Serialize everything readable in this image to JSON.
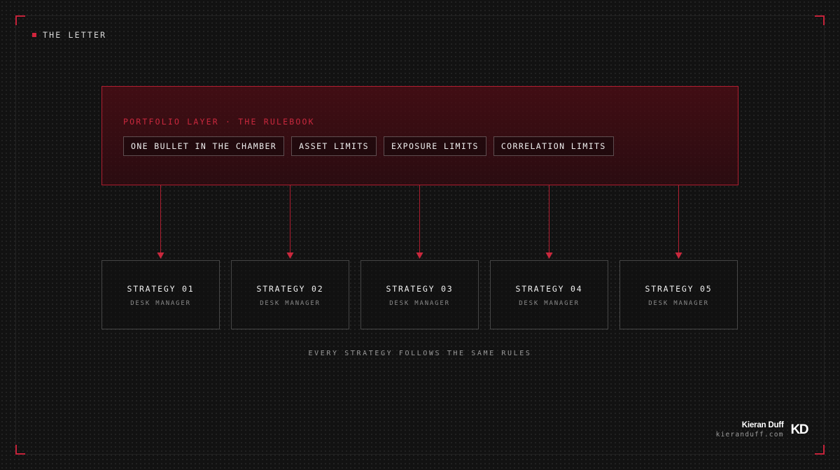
{
  "section_label": "THE LETTER",
  "portfolio": {
    "title": "PORTFOLIO LAYER · THE RULEBOOK",
    "rules": [
      "ONE BULLET IN THE CHAMBER",
      "ASSET LIMITS",
      "EXPOSURE LIMITS",
      "CORRELATION LIMITS"
    ]
  },
  "strategies": [
    {
      "name": "STRATEGY 01",
      "role": "DESK MANAGER"
    },
    {
      "name": "STRATEGY 02",
      "role": "DESK MANAGER"
    },
    {
      "name": "STRATEGY 03",
      "role": "DESK MANAGER"
    },
    {
      "name": "STRATEGY 04",
      "role": "DESK MANAGER"
    },
    {
      "name": "STRATEGY 05",
      "role": "DESK MANAGER"
    }
  ],
  "caption": "EVERY STRATEGY FOLLOWS THE SAME RULES",
  "brand": {
    "name": "Kieran Duff",
    "url": "kieranduff.com",
    "logo": "KD"
  },
  "colors": {
    "accent": "#c9283d",
    "background": "#121212"
  }
}
